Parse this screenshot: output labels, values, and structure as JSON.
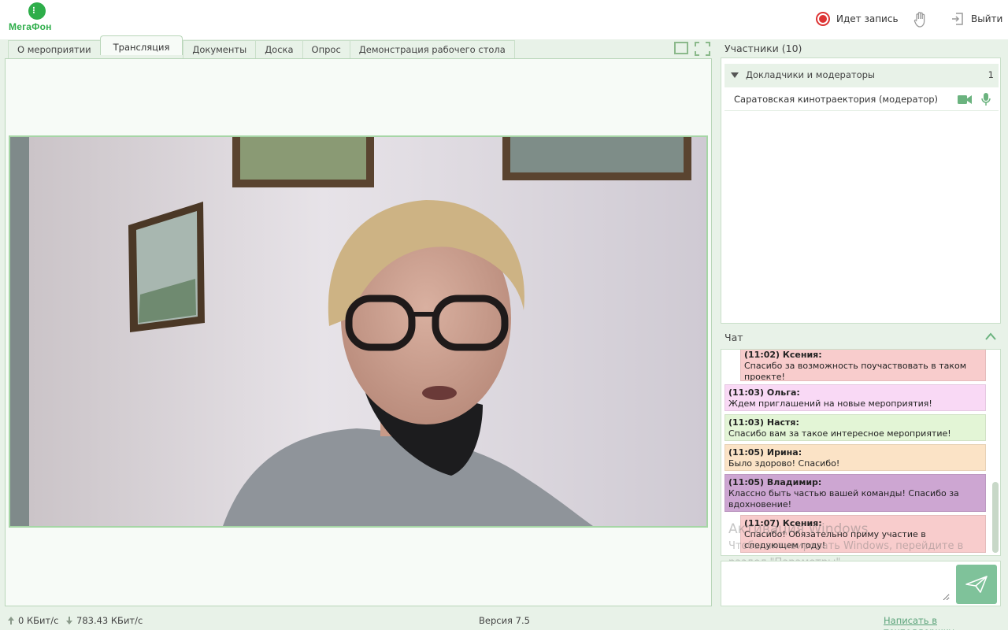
{
  "header": {
    "logo_text": "МегаФон",
    "logo_glyph": "⁝",
    "recording_label": "Идет запись",
    "exit_label": "Выйти",
    "icons": [
      "record-icon",
      "raise-hand-icon",
      "exit-icon"
    ]
  },
  "tabs": [
    {
      "label": "О мероприятии"
    },
    {
      "label": "Трансляция",
      "active": true
    },
    {
      "label": "Документы"
    },
    {
      "label": "Доска"
    },
    {
      "label": "Опрос"
    },
    {
      "label": "Демонстрация рабочего стола"
    }
  ],
  "participants": {
    "title": "Участники (10)",
    "group_label": "Докладчики и модераторы",
    "group_count": "1",
    "items": [
      {
        "name": "Саратовская кинотраектория (модератор)"
      }
    ]
  },
  "chat": {
    "title": "Чат",
    "messages": [
      {
        "author": "(11:02) Ксения:",
        "text": "Спасибо за возможность поучаствовать в таком проекте!",
        "color": "#f8cccc"
      },
      {
        "author": "(11:03) Ольга:",
        "text": "Ждем приглашений на новые мероприятия!",
        "color": "#f9d9f5"
      },
      {
        "author": "(11:03) Настя:",
        "text": "Спасибо вам за такое интересное мероприятие!",
        "color": "#e3f5d6"
      },
      {
        "author": "(11:05) Ирина:",
        "text": "Было здорово! Спасибо!",
        "color": "#fbe3c6"
      },
      {
        "author": "(11:05) Владимир:",
        "text": "Классно быть частью вашей команды! Спасибо за вдохновение!",
        "color": "#cda6d2"
      },
      {
        "author": "(11:07) Ксения:",
        "text": "Спасибо! Обязательно приму участие в следующем году!",
        "color": "#f8cccc"
      }
    ],
    "input_placeholder": "",
    "send_icon": "paper-plane-icon"
  },
  "watermark": {
    "line1": "Активация Windows",
    "line2": "Чтобы активировать Windows, перейдите в",
    "line3": "раздел \"Параметры\"."
  },
  "footer": {
    "upload": "0 КБит/с",
    "download": "783.43 КБит/с",
    "version": "Версия 7.5",
    "support_link": "Написать в техподдержку"
  }
}
